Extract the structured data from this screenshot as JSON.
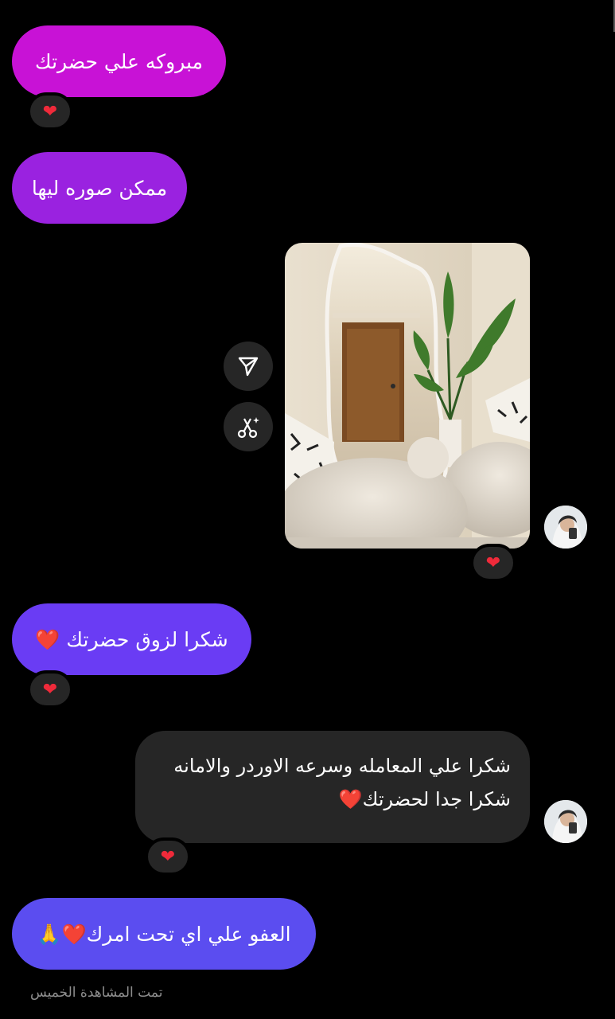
{
  "colors": {
    "background": "#000000",
    "sent_magenta": "#c812d6",
    "sent_purple_1": "#9a22e0",
    "sent_purple_2": "#6a3cf4",
    "sent_violet": "#5b4df0",
    "received": "#262626",
    "heart": "#ef2a3a"
  },
  "messages": [
    {
      "id": "m1",
      "text": "مبروكه علي حضرتك"
    },
    {
      "id": "m2",
      "text": "ممكن صوره ليها"
    },
    {
      "id": "m4",
      "text": "شكرا لزوق حضرتك ❤️"
    },
    {
      "id": "m5",
      "lines": [
        "شكرا علي المعامله وسرعه الاوردر والامانه",
        "شكرا جدا لحضرتك❤️"
      ]
    },
    {
      "id": "m6",
      "text": "العفو علي اي تحت امرك❤️🙏"
    }
  ],
  "reactions": {
    "heart": "❤"
  },
  "icons": {
    "share": "share-icon",
    "cut": "scissors-sparkle-icon",
    "heart": "heart-icon"
  },
  "footer": {
    "seen_text": "تمت المشاهدة الخميس"
  }
}
